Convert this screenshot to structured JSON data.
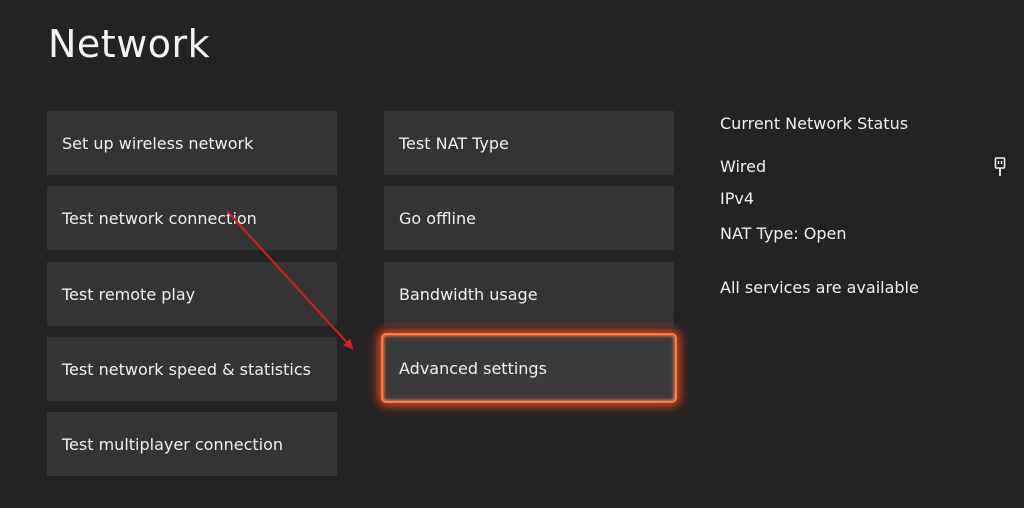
{
  "page": {
    "title": "Network"
  },
  "left_column": [
    {
      "label": "Set up wireless network"
    },
    {
      "label": "Test network connection"
    },
    {
      "label": "Test remote play"
    },
    {
      "label": "Test network speed & statistics"
    },
    {
      "label": "Test multiplayer connection"
    }
  ],
  "middle_column": [
    {
      "label": "Test NAT Type"
    },
    {
      "label": "Go offline"
    },
    {
      "label": "Bandwidth usage"
    },
    {
      "label": "Advanced settings"
    }
  ],
  "status": {
    "heading": "Current Network Status",
    "connection": "Wired",
    "connection_icon": "ethernet-plug-icon",
    "protocol": "IPv4",
    "nat": "NAT Type: Open",
    "services": "All services are available"
  },
  "annotation": {
    "arrow_color": "#e01b1b",
    "focus_color": "#ff7a3c"
  }
}
